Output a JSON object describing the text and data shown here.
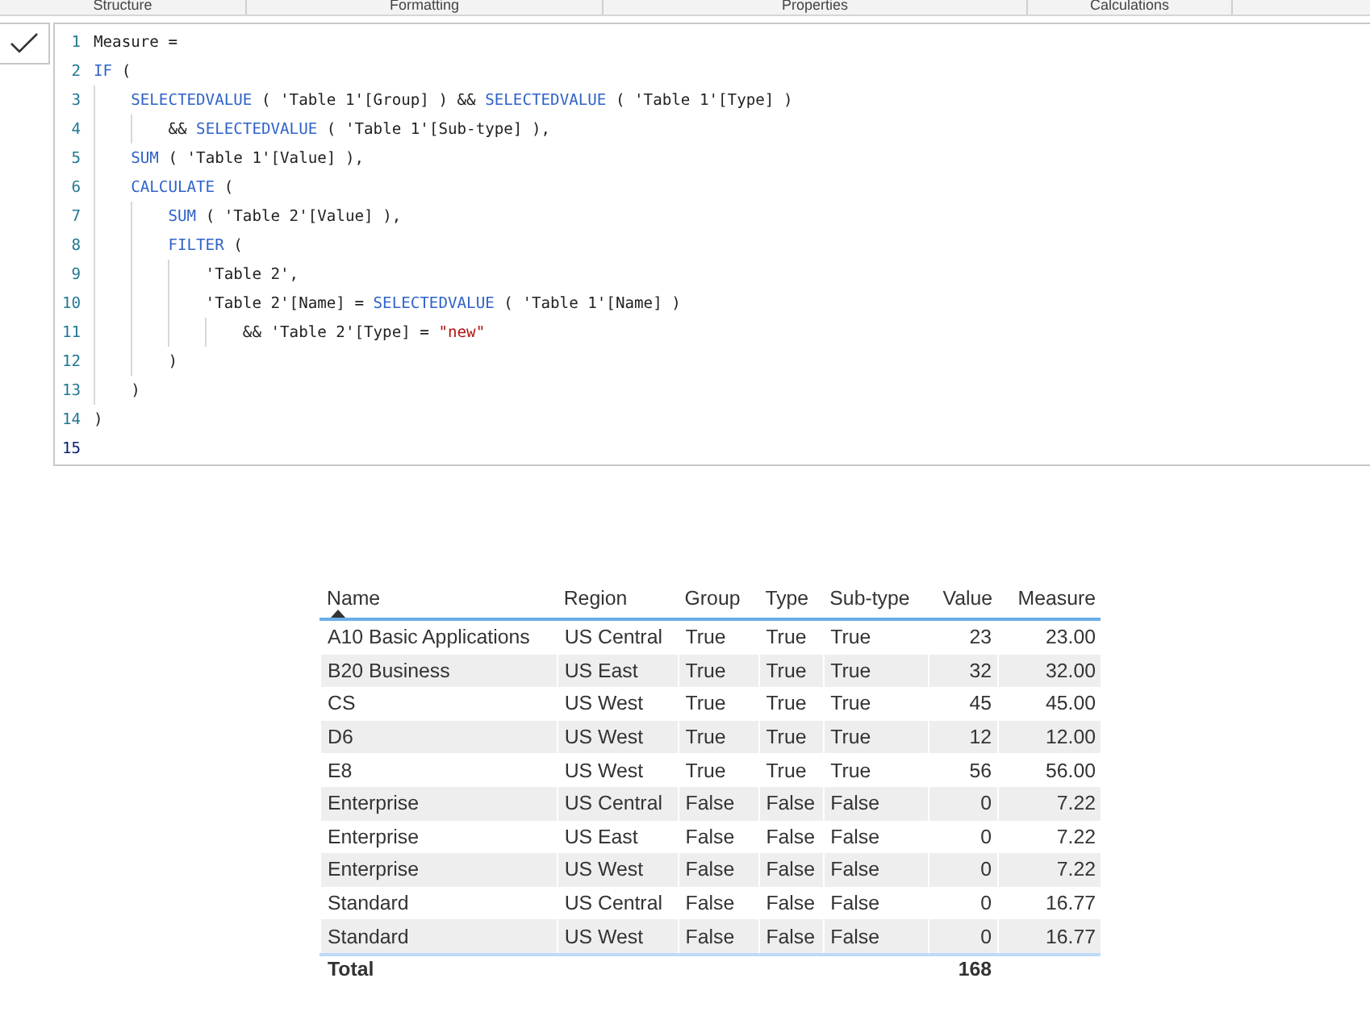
{
  "tabs": [
    {
      "label": "Structure"
    },
    {
      "label": "Formatting"
    },
    {
      "label": "Properties"
    },
    {
      "label": "Calculations"
    }
  ],
  "editor": {
    "lines": [
      [
        {
          "kind": "plain",
          "text": "Measure ="
        }
      ],
      [
        {
          "kind": "keyword",
          "text": "IF"
        },
        {
          "kind": "plain",
          "text": " ("
        }
      ],
      [
        {
          "kind": "keyword",
          "text": "    SELECTEDVALUE"
        },
        {
          "kind": "plain",
          "text": " ( 'Table 1'[Group] ) && "
        },
        {
          "kind": "keyword",
          "text": "SELECTEDVALUE"
        },
        {
          "kind": "plain",
          "text": " ( 'Table 1'[Type] )"
        }
      ],
      [
        {
          "kind": "plain",
          "text": "        && "
        },
        {
          "kind": "keyword",
          "text": "SELECTEDVALUE"
        },
        {
          "kind": "plain",
          "text": " ( 'Table 1'[Sub-type] ),"
        }
      ],
      [
        {
          "kind": "keyword",
          "text": "    SUM"
        },
        {
          "kind": "plain",
          "text": " ( 'Table 1'[Value] ),"
        }
      ],
      [
        {
          "kind": "keyword",
          "text": "    CALCULATE"
        },
        {
          "kind": "plain",
          "text": " ("
        }
      ],
      [
        {
          "kind": "keyword",
          "text": "        SUM"
        },
        {
          "kind": "plain",
          "text": " ( 'Table 2'[Value] ),"
        }
      ],
      [
        {
          "kind": "keyword",
          "text": "        FILTER"
        },
        {
          "kind": "plain",
          "text": " ("
        }
      ],
      [
        {
          "kind": "plain",
          "text": "            'Table 2',"
        }
      ],
      [
        {
          "kind": "plain",
          "text": "            'Table 2'[Name] = "
        },
        {
          "kind": "keyword",
          "text": "SELECTEDVALUE"
        },
        {
          "kind": "plain",
          "text": " ( 'Table 1'[Name] )"
        }
      ],
      [
        {
          "kind": "plain",
          "text": "                && 'Table 2'[Type] = "
        },
        {
          "kind": "string",
          "text": "\"new\""
        }
      ],
      [
        {
          "kind": "plain",
          "text": "        )"
        }
      ],
      [
        {
          "kind": "plain",
          "text": "    )"
        }
      ],
      [
        {
          "kind": "plain",
          "text": ")"
        }
      ]
    ],
    "line_numbers": [
      "1",
      "2",
      "3",
      "4",
      "5",
      "6",
      "7",
      "8",
      "9",
      "10",
      "11",
      "12",
      "13",
      "14",
      "15"
    ]
  },
  "table": {
    "columns": [
      {
        "label": "Name",
        "sorted": true,
        "kind": "text"
      },
      {
        "label": "Region",
        "sorted": false,
        "kind": "text"
      },
      {
        "label": "Group",
        "sorted": false,
        "kind": "text"
      },
      {
        "label": "Type",
        "sorted": false,
        "kind": "text"
      },
      {
        "label": "Sub-type",
        "sorted": false,
        "kind": "text"
      },
      {
        "label": "Value",
        "sorted": false,
        "kind": "number"
      },
      {
        "label": "Measure",
        "sorted": false,
        "kind": "number"
      }
    ],
    "rows": [
      [
        "A10 Basic Applications",
        "US Central",
        "True",
        "True",
        "True",
        "23",
        "23.00"
      ],
      [
        "B20 Business",
        "US East",
        "True",
        "True",
        "True",
        "32",
        "32.00"
      ],
      [
        "CS",
        "US West",
        "True",
        "True",
        "True",
        "45",
        "45.00"
      ],
      [
        "D6",
        "US West",
        "True",
        "True",
        "True",
        "12",
        "12.00"
      ],
      [
        "E8",
        "US West",
        "True",
        "True",
        "True",
        "56",
        "56.00"
      ],
      [
        "Enterprise",
        "US Central",
        "False",
        "False",
        "False",
        "0",
        "7.22"
      ],
      [
        "Enterprise",
        "US East",
        "False",
        "False",
        "False",
        "0",
        "7.22"
      ],
      [
        "Enterprise",
        "US West",
        "False",
        "False",
        "False",
        "0",
        "7.22"
      ],
      [
        "Standard",
        "US Central",
        "False",
        "False",
        "False",
        "0",
        "16.77"
      ],
      [
        "Standard",
        "US West",
        "False",
        "False",
        "False",
        "0",
        "16.77"
      ]
    ],
    "total": {
      "label": "Total",
      "value": "168"
    }
  }
}
